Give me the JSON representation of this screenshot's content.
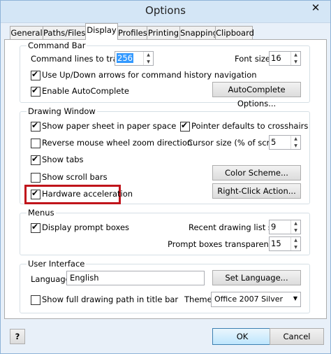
{
  "window": {
    "title": "Options",
    "close": "✕"
  },
  "tabs": [
    "General",
    "Paths/Files",
    "Display",
    "Profiles",
    "Printing",
    "Snapping",
    "Clipboard"
  ],
  "command_bar": {
    "title": "Command Bar",
    "lines_label": "Command lines to track:",
    "lines_value": "256",
    "font_label": "Font size:",
    "font_value": "16",
    "updown_label": "Use Up/Down arrows for command history navigation",
    "autocomplete_label": "Enable AutoComplete",
    "autocomplete_options": "AutoComplete Options..."
  },
  "drawing_window": {
    "title": "Drawing Window",
    "paper_label": "Show paper sheet in paper space",
    "pointer_label": "Pointer defaults to crosshairs",
    "reverse_label": "Reverse mouse wheel zoom direction",
    "cursor_label": "Cursor size (% of screen):",
    "cursor_value": "5",
    "tabs_label": "Show tabs",
    "scroll_label": "Show scroll bars",
    "color_scheme": "Color Scheme...",
    "hw_label": "Hardware acceleration",
    "right_click": "Right-Click Action..."
  },
  "menus": {
    "title": "Menus",
    "prompt_label": "Display prompt boxes",
    "recent_label": "Recent drawing list size:",
    "recent_value": "9",
    "transparency_label": "Prompt boxes transparency (%):",
    "transparency_value": "15"
  },
  "ui": {
    "title": "User Interface",
    "language_label": "Language",
    "language_value": "English",
    "set_language": "Set Language...",
    "fullpath_label": "Show full drawing path in title bar",
    "theme_label": "Theme",
    "theme_value": "Office 2007 Silver"
  },
  "footer": {
    "help": "?",
    "ok": "OK",
    "cancel": "Cancel"
  },
  "colors": {
    "highlight": "#c0141b",
    "titlebar": "#d4e6f6"
  },
  "icons": {
    "check": "✔",
    "up": "▲",
    "down": "▼",
    "dropdown": "▼"
  }
}
